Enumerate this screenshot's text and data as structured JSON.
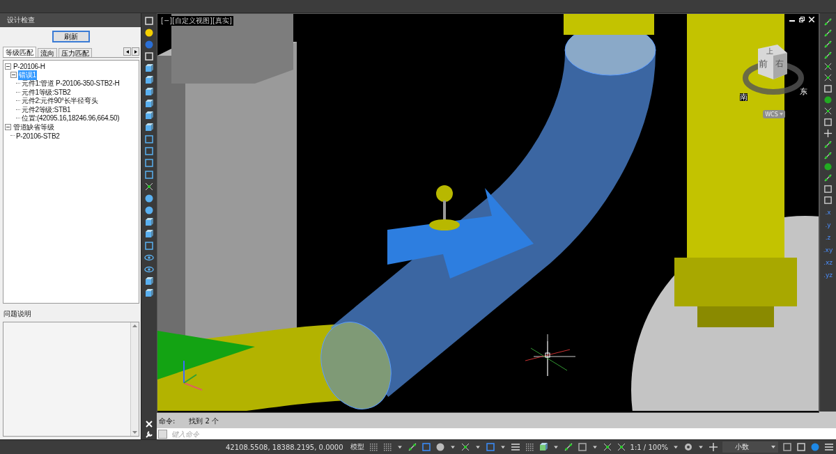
{
  "panel": {
    "title": "设计检查",
    "refresh_button": "刷新",
    "tabs": [
      {
        "label": "等级匹配",
        "selected": true
      },
      {
        "label": "流向",
        "selected": false
      },
      {
        "label": "压力匹配",
        "selected": false
      }
    ],
    "tree": [
      {
        "label": "P-20106-H",
        "expanded": true,
        "selected": false,
        "children": [
          {
            "label": "错误1",
            "expanded": true,
            "selected": true,
            "children": [
              {
                "label": "元件1:管道 P-20106-350-STB2-H",
                "selected": false
              },
              {
                "label": "元件1等级:STB2",
                "selected": false
              },
              {
                "label": "元件2:元件90°长半径弯头",
                "selected": false
              },
              {
                "label": "元件2等级:STB1",
                "selected": false
              },
              {
                "label": "位置:(42095.16,18246.96,664.50)",
                "selected": false
              }
            ]
          }
        ]
      },
      {
        "label": "管道缺省等级",
        "expanded": true,
        "selected": false,
        "children": [
          {
            "label": "P-20106-STB2",
            "selected": false
          }
        ]
      }
    ],
    "description_label": "问题说明"
  },
  "viewport": {
    "label": "[−][自定义视图][真实]",
    "viewcube": {
      "faces": [
        "上",
        "前",
        "右"
      ],
      "compass": [
        "南",
        "东"
      ],
      "ucs": "WCS"
    }
  },
  "snap_toolbar": {
    "axes": [
      ".x",
      ".y",
      ".z",
      ".xy",
      ".xz",
      ".yz"
    ]
  },
  "command": {
    "prompt": "命令:",
    "result": "找到 2 个",
    "placeholder": "键入命令"
  },
  "status_bar": {
    "coordinates": "42108.5508, 18388.2195, 0.0000",
    "space": "模型",
    "scale": "1:1 / 100%",
    "units": "小数"
  }
}
